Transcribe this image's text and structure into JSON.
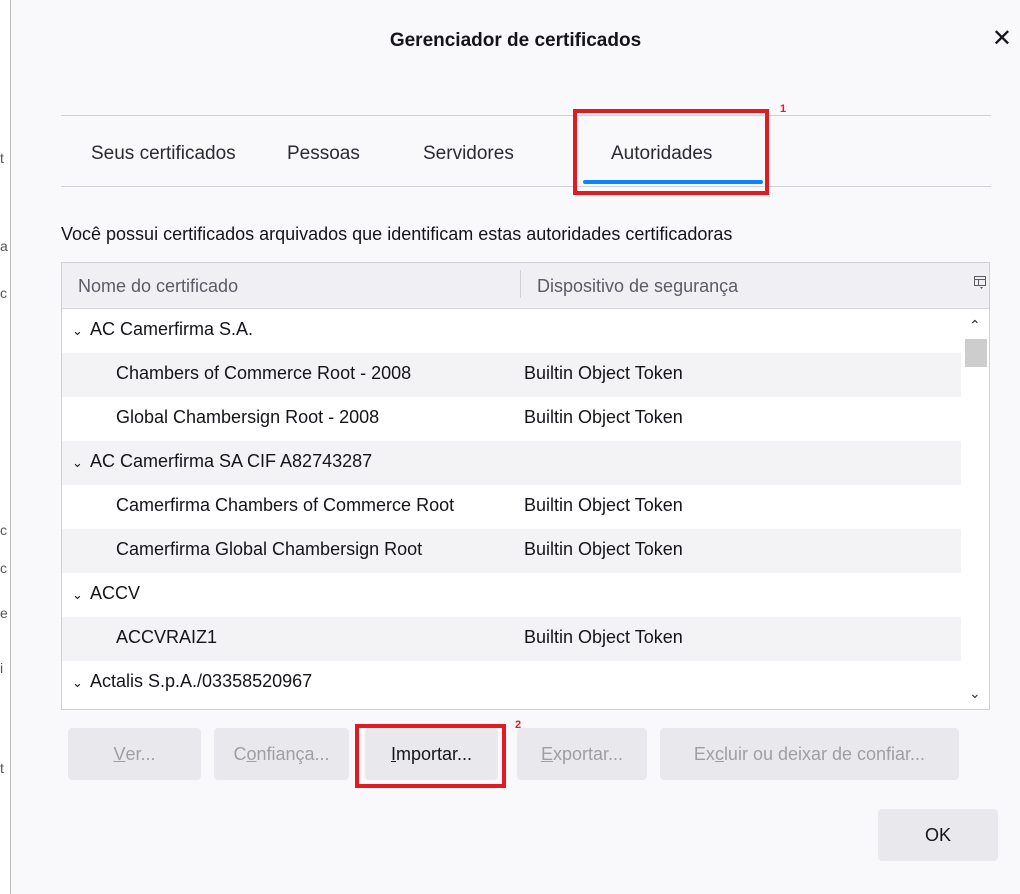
{
  "dialog": {
    "title": "Gerenciador de certificados",
    "close_glyph": "✕"
  },
  "tabs": [
    {
      "label": "Seus certificados"
    },
    {
      "label": "Pessoas"
    },
    {
      "label": "Servidores"
    },
    {
      "label": "Autoridades",
      "selected": true
    }
  ],
  "annotations": {
    "tab_marker": "1",
    "button_marker": "2",
    "color": "#e01b24"
  },
  "description": "Você possui certificados arquivados que identificam estas autoridades certificadoras",
  "table": {
    "columns": [
      "Nome do certificado",
      "Dispositivo de segurança"
    ],
    "rows": [
      {
        "type": "group",
        "name": "AC Camerfirma S.A.",
        "device": ""
      },
      {
        "type": "item",
        "name": "Chambers of Commerce Root - 2008",
        "device": "Builtin Object Token"
      },
      {
        "type": "item",
        "name": "Global Chambersign Root - 2008",
        "device": "Builtin Object Token"
      },
      {
        "type": "group",
        "name": "AC Camerfirma SA CIF A82743287",
        "device": ""
      },
      {
        "type": "item",
        "name": "Camerfirma Chambers of Commerce Root",
        "device": "Builtin Object Token"
      },
      {
        "type": "item",
        "name": "Camerfirma Global Chambersign Root",
        "device": "Builtin Object Token"
      },
      {
        "type": "group",
        "name": "ACCV",
        "device": ""
      },
      {
        "type": "item",
        "name": "ACCVRAIZ1",
        "device": "Builtin Object Token"
      },
      {
        "type": "group",
        "name": "Actalis S.p.A./03358520967",
        "device": ""
      }
    ]
  },
  "buttons": {
    "view": {
      "label_accesskey": "V",
      "label_rest": "er..."
    },
    "trust": {
      "label_pre": "C",
      "label_accesskey": "o",
      "label_rest": "nfiança..."
    },
    "import": {
      "label_accesskey": "I",
      "label_rest": "mportar..."
    },
    "export": {
      "label_accesskey": "E",
      "label_rest": "xportar..."
    },
    "delete": {
      "label_pre": "Ex",
      "label_accesskey": "c",
      "label_rest": "luir ou deixar de confiar..."
    },
    "ok": "OK"
  },
  "colors": {
    "accent": "#0a84ff",
    "highlight": "#e01b24"
  }
}
